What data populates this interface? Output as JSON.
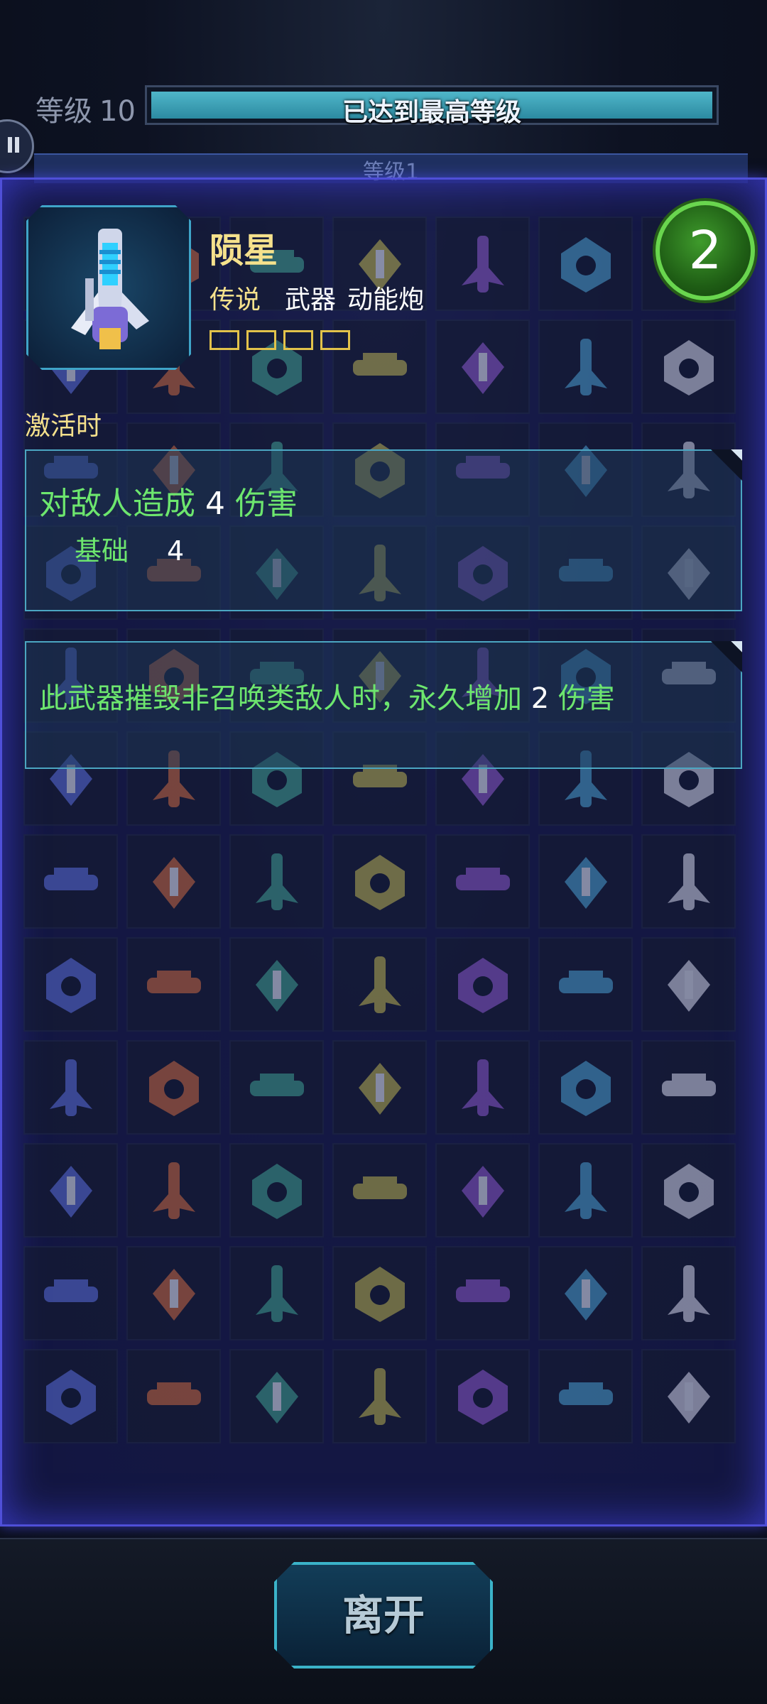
{
  "header": {
    "level_label": "等级",
    "level_value": "10",
    "level_bar_text": "已达到最高等级",
    "level_progress": 1.0,
    "sub_tab_label": "等级1"
  },
  "item": {
    "name": "陨星",
    "rarity": "传说",
    "category": "武器",
    "subtype": "动能炮",
    "slot_count": 4,
    "level_badge": "2"
  },
  "effects": {
    "trigger_label": "激活时",
    "primary": {
      "prefix": "对敌人造成",
      "amount": "4",
      "suffix": "伤害",
      "base_label": "基础",
      "base_value": "4"
    },
    "passive": {
      "prefix": "此武器摧毁非召唤类敌人时，永久增加",
      "amount": "2",
      "suffix": "伤害"
    }
  },
  "footer": {
    "leave_label": "离开"
  },
  "colors": {
    "panel_border": "#4f4fd8",
    "effect_text": "#6de66e",
    "highlight_gold": "#f5e18c",
    "badge_green": "#69d64e"
  }
}
